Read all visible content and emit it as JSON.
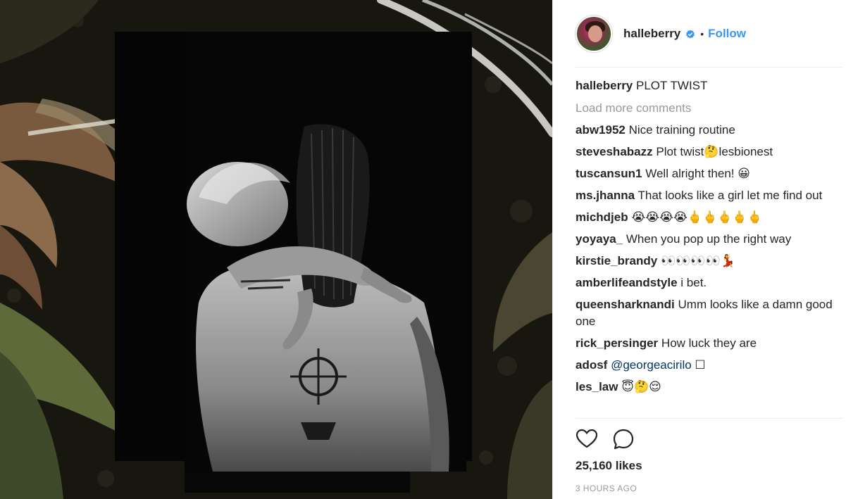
{
  "post": {
    "image_alt": "",
    "author": "halleberry",
    "follow_label": "Follow",
    "dot": "•",
    "caption": {
      "user": "halleberry",
      "text": "PLOT TWIST"
    },
    "load_more_label": "Load more comments",
    "comments": [
      {
        "user": "abw1952",
        "text": "Nice training routine"
      },
      {
        "user": "steveshabazz",
        "text": "Plot twist🤔lesbionest"
      },
      {
        "user": "tuscansun1",
        "text": "Well alright then! 😀"
      },
      {
        "user": "ms.jhanna",
        "text": "That looks like a girl let me find out"
      },
      {
        "user": "michdjeb",
        "text": "😭😭😭😭🖕🖕🖕🖕🖕"
      },
      {
        "user": "yoyaya_",
        "text": "When you pop up the right way"
      },
      {
        "user": "kirstie_brandy",
        "text": "👀👀👀👀💃"
      },
      {
        "user": "amberlifeandstyle",
        "text": "i bet."
      },
      {
        "user": "queensharknandi",
        "text": "Umm looks like a damn good one"
      },
      {
        "user": "rick_persinger",
        "text": "How luck they are"
      },
      {
        "user": "adosf",
        "mention": "@georgeacirilo",
        "text": "☐"
      },
      {
        "user": "les_law",
        "text": "😇🤔😌"
      }
    ],
    "likes": "25,160 likes",
    "timestamp": "3 HOURS AGO",
    "icons": {
      "verified": "verified-badge-icon",
      "like": "heart-icon",
      "comment": "comment-bubble-icon"
    },
    "colors": {
      "accent": "#3897f0",
      "text": "#262626",
      "muted": "#999999",
      "mention": "#003569"
    }
  }
}
